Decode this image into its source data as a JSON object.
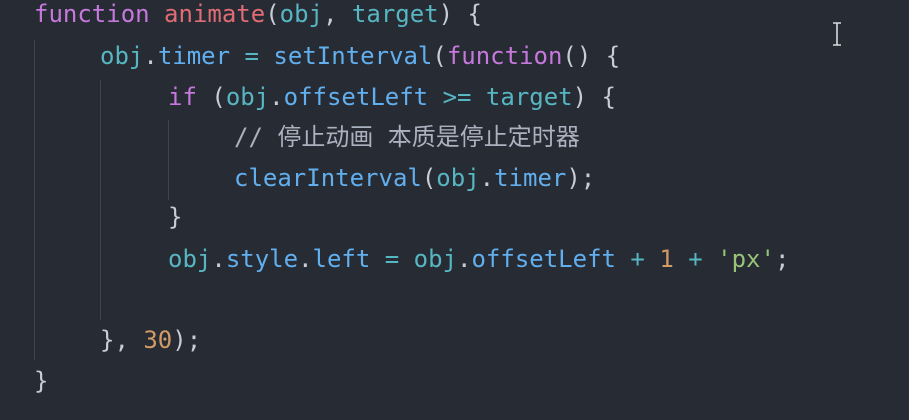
{
  "editor": {
    "lines": [
      {
        "id": "line-1",
        "tokens": [
          {
            "text": "function",
            "kind": "keyword"
          },
          {
            "text": " ",
            "kind": "punct"
          },
          {
            "text": "animate",
            "kind": "func"
          },
          {
            "text": "(",
            "kind": "punct"
          },
          {
            "text": "obj",
            "kind": "var"
          },
          {
            "text": ", ",
            "kind": "punct"
          },
          {
            "text": "target",
            "kind": "var"
          },
          {
            "text": ") {",
            "kind": "punct"
          }
        ]
      },
      {
        "id": "line-2",
        "tokens": [
          {
            "text": "obj",
            "kind": "var"
          },
          {
            "text": ".",
            "kind": "punct"
          },
          {
            "text": "timer",
            "kind": "prop"
          },
          {
            "text": " = ",
            "kind": "op"
          },
          {
            "text": "setInterval",
            "kind": "fn2"
          },
          {
            "text": "(",
            "kind": "punct"
          },
          {
            "text": "function",
            "kind": "keyword"
          },
          {
            "text": "() {",
            "kind": "punct"
          }
        ]
      },
      {
        "id": "line-3",
        "tokens": [
          {
            "text": "if",
            "kind": "keyword"
          },
          {
            "text": " (",
            "kind": "punct"
          },
          {
            "text": "obj",
            "kind": "var"
          },
          {
            "text": ".",
            "kind": "punct"
          },
          {
            "text": "offsetLeft",
            "kind": "prop"
          },
          {
            "text": " >= ",
            "kind": "op"
          },
          {
            "text": "target",
            "kind": "var"
          },
          {
            "text": ") {",
            "kind": "punct"
          }
        ]
      },
      {
        "id": "line-4",
        "tokens": [
          {
            "text": "// 停止动画 本质是停止定时器",
            "kind": "comment"
          }
        ]
      },
      {
        "id": "line-5",
        "tokens": [
          {
            "text": "clearInterval",
            "kind": "fn2"
          },
          {
            "text": "(",
            "kind": "punct"
          },
          {
            "text": "obj",
            "kind": "var"
          },
          {
            "text": ".",
            "kind": "punct"
          },
          {
            "text": "timer",
            "kind": "prop"
          },
          {
            "text": ");",
            "kind": "punct"
          }
        ]
      },
      {
        "id": "line-6",
        "tokens": [
          {
            "text": "}",
            "kind": "punct"
          }
        ]
      },
      {
        "id": "line-7",
        "tokens": [
          {
            "text": "obj",
            "kind": "var"
          },
          {
            "text": ".",
            "kind": "punct"
          },
          {
            "text": "style",
            "kind": "prop"
          },
          {
            "text": ".",
            "kind": "punct"
          },
          {
            "text": "left",
            "kind": "prop"
          },
          {
            "text": " = ",
            "kind": "op"
          },
          {
            "text": "obj",
            "kind": "var"
          },
          {
            "text": ".",
            "kind": "punct"
          },
          {
            "text": "offsetLeft",
            "kind": "prop"
          },
          {
            "text": " + ",
            "kind": "op"
          },
          {
            "text": "1",
            "kind": "num"
          },
          {
            "text": " + ",
            "kind": "op"
          },
          {
            "text": "'px'",
            "kind": "str"
          },
          {
            "text": ";",
            "kind": "punct"
          }
        ]
      },
      {
        "id": "line-8",
        "tokens": []
      },
      {
        "id": "line-9",
        "tokens": [
          {
            "text": "}",
            "kind": "punct"
          },
          {
            "text": ", ",
            "kind": "punct"
          },
          {
            "text": "30",
            "kind": "num"
          },
          {
            "text": ");",
            "kind": "punct"
          }
        ]
      },
      {
        "id": "line-10",
        "tokens": [
          {
            "text": "}",
            "kind": "punct"
          }
        ]
      }
    ]
  },
  "cursor": {
    "icon": "text-cursor-icon"
  },
  "colors": {
    "background": "#272b33",
    "keyword": "#c678dd",
    "function_name": "#e06c75",
    "variable": "#56b6c2",
    "property": "#61afef",
    "string": "#98c379",
    "number": "#d19a66",
    "comment": "#abb2bf"
  }
}
